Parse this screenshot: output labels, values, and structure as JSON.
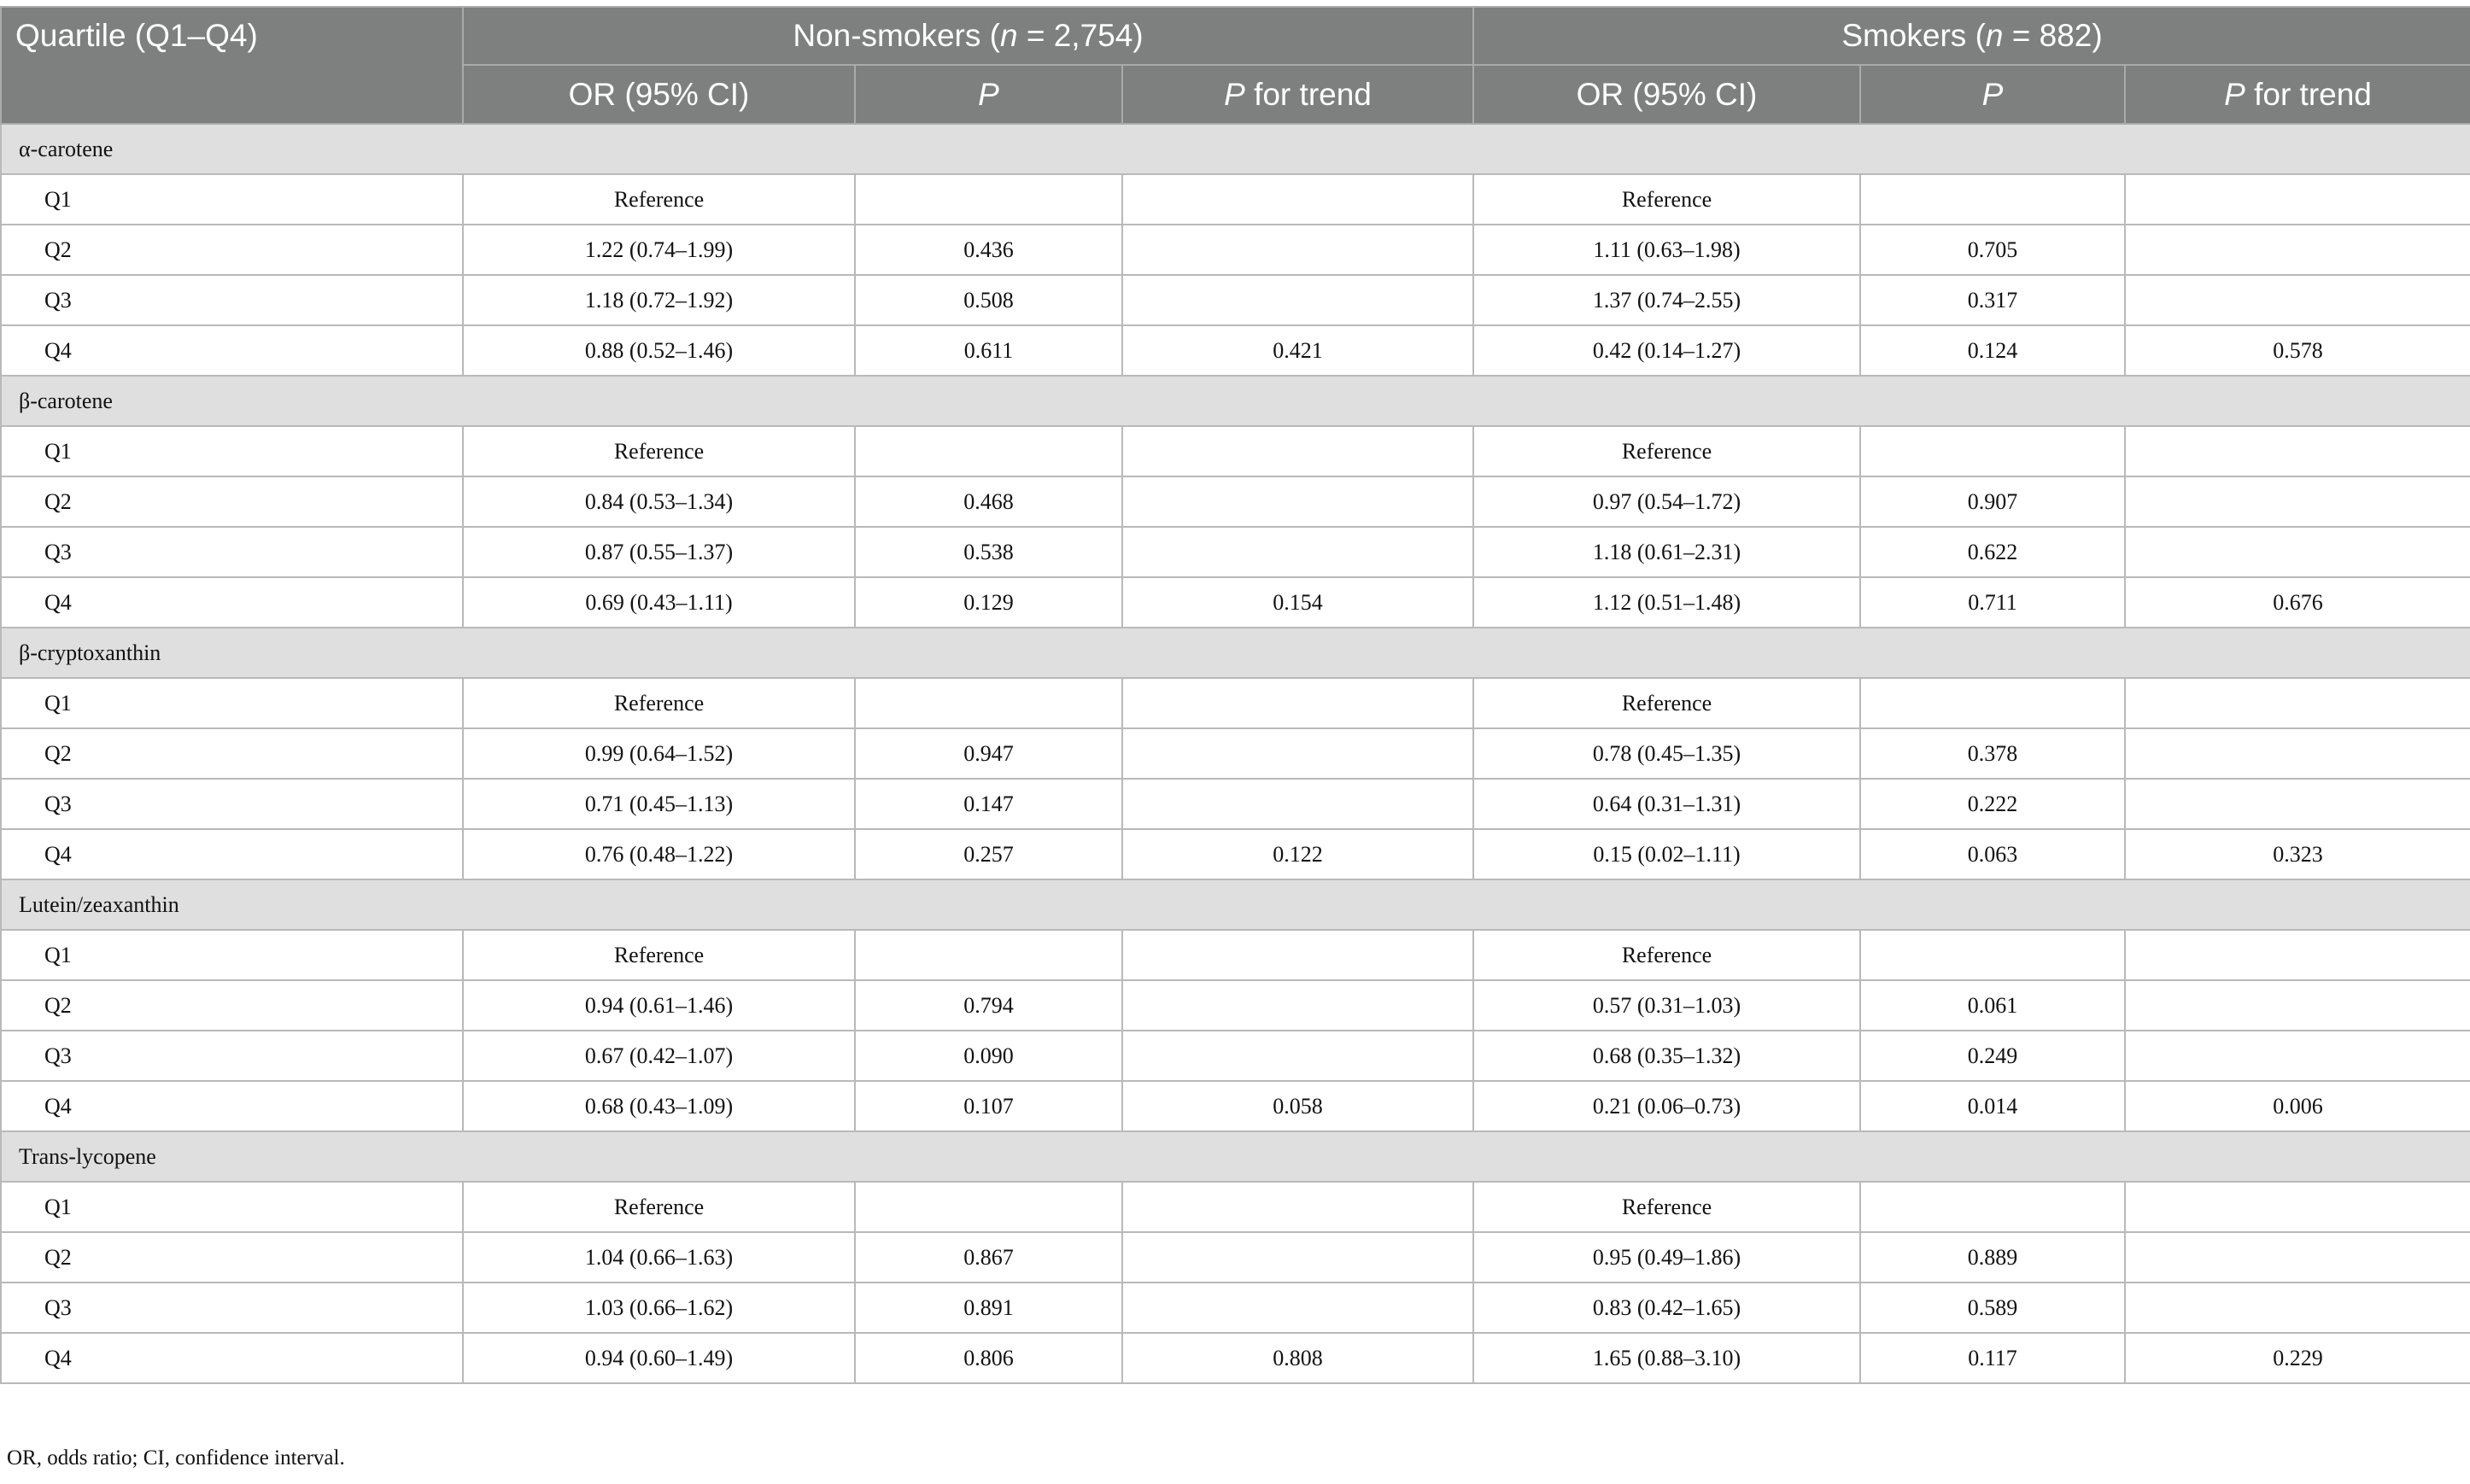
{
  "header": {
    "quartile": "Quartile (Q1–Q4)",
    "nonsmokers": {
      "pre": "Non-smokers (",
      "n_italic": "n",
      "post": " = 2,754)"
    },
    "smokers": {
      "pre": "Smokers (",
      "n_italic": "n",
      "post": " = 882)"
    },
    "or_ci": "OR (95% CI)",
    "p": "P",
    "p_trend_italic": "P",
    "p_trend_rest": " for trend"
  },
  "sections": [
    {
      "title": "α-carotene",
      "rows": [
        [
          "Q1",
          "Reference",
          "",
          "",
          "Reference",
          "",
          ""
        ],
        [
          "Q2",
          "1.22 (0.74–1.99)",
          "0.436",
          "",
          "1.11 (0.63–1.98)",
          "0.705",
          ""
        ],
        [
          "Q3",
          "1.18 (0.72–1.92)",
          "0.508",
          "",
          "1.37 (0.74–2.55)",
          "0.317",
          ""
        ],
        [
          "Q4",
          "0.88 (0.52–1.46)",
          "0.611",
          "0.421",
          "0.42 (0.14–1.27)",
          "0.124",
          "0.578"
        ]
      ]
    },
    {
      "title": "β-carotene",
      "rows": [
        [
          "Q1",
          "Reference",
          "",
          "",
          "Reference",
          "",
          ""
        ],
        [
          "Q2",
          "0.84 (0.53–1.34)",
          "0.468",
          "",
          "0.97 (0.54–1.72)",
          "0.907",
          ""
        ],
        [
          "Q3",
          "0.87 (0.55–1.37)",
          "0.538",
          "",
          "1.18 (0.61–2.31)",
          "0.622",
          ""
        ],
        [
          "Q4",
          "0.69 (0.43–1.11)",
          "0.129",
          "0.154",
          "1.12 (0.51–1.48)",
          "0.711",
          "0.676"
        ]
      ]
    },
    {
      "title": "β-cryptoxanthin",
      "rows": [
        [
          "Q1",
          "Reference",
          "",
          "",
          "Reference",
          "",
          ""
        ],
        [
          "Q2",
          "0.99 (0.64–1.52)",
          "0.947",
          "",
          "0.78 (0.45–1.35)",
          "0.378",
          ""
        ],
        [
          "Q3",
          "0.71 (0.45–1.13)",
          "0.147",
          "",
          "0.64 (0.31–1.31)",
          "0.222",
          ""
        ],
        [
          "Q4",
          "0.76 (0.48–1.22)",
          "0.257",
          "0.122",
          "0.15 (0.02–1.11)",
          "0.063",
          "0.323"
        ]
      ]
    },
    {
      "title": "Lutein/zeaxanthin",
      "rows": [
        [
          "Q1",
          "Reference",
          "",
          "",
          "Reference",
          "",
          ""
        ],
        [
          "Q2",
          "0.94 (0.61–1.46)",
          "0.794",
          "",
          "0.57 (0.31–1.03)",
          "0.061",
          ""
        ],
        [
          "Q3",
          "0.67 (0.42–1.07)",
          "0.090",
          "",
          "0.68 (0.35–1.32)",
          "0.249",
          ""
        ],
        [
          "Q4",
          "0.68 (0.43–1.09)",
          "0.107",
          "0.058",
          "0.21 (0.06–0.73)",
          "0.014",
          "0.006"
        ]
      ]
    },
    {
      "title": "Trans-lycopene",
      "rows": [
        [
          "Q1",
          "Reference",
          "",
          "",
          "Reference",
          "",
          ""
        ],
        [
          "Q2",
          "1.04 (0.66–1.63)",
          "0.867",
          "",
          "0.95 (0.49–1.86)",
          "0.889",
          ""
        ],
        [
          "Q3",
          "1.03 (0.66–1.62)",
          "0.891",
          "",
          "0.83 (0.42–1.65)",
          "0.589",
          ""
        ],
        [
          "Q4",
          "0.94 (0.60–1.49)",
          "0.806",
          "0.808",
          "1.65 (0.88–3.10)",
          "0.117",
          "0.229"
        ]
      ]
    }
  ],
  "footnote": "OR, odds ratio; CI, confidence interval."
}
